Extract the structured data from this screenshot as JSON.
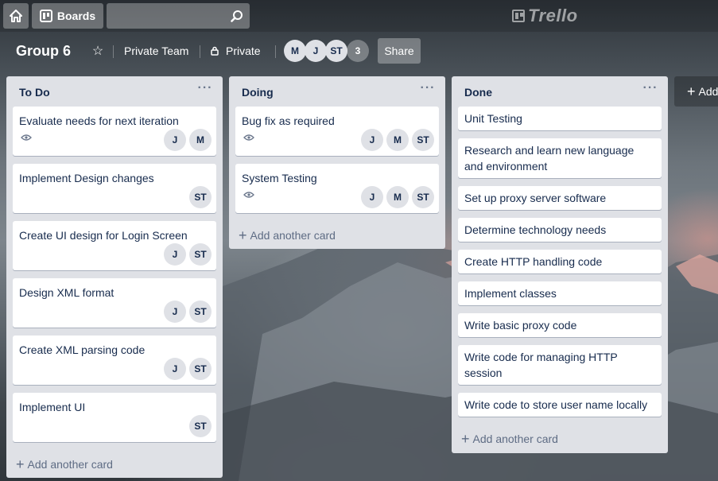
{
  "nav": {
    "home_icon": "home-icon",
    "boards_label": "Boards",
    "boards_icon": "boards-icon",
    "search_placeholder": "",
    "search_icon": "search-icon",
    "logo_text": "Trello"
  },
  "board": {
    "title": "Group 6",
    "star_icon": "star-icon",
    "team_label": "Private Team",
    "visibility_label": "Private",
    "visibility_icon": "lock-icon",
    "members": [
      "M",
      "J",
      "ST"
    ],
    "extra_members": "3",
    "share_label": "Share"
  },
  "lists": [
    {
      "title": "To Do",
      "cards": [
        {
          "title": "Evaluate needs for next iteration",
          "watch": true,
          "members": [
            "J",
            "M"
          ]
        },
        {
          "title": "Implement Design changes",
          "watch": false,
          "members": [
            "ST"
          ]
        },
        {
          "title": "Create UI design for Login Screen",
          "watch": false,
          "members": [
            "J",
            "ST"
          ]
        },
        {
          "title": "Design XML format",
          "watch": false,
          "members": [
            "J",
            "ST"
          ]
        },
        {
          "title": "Create XML parsing code",
          "watch": false,
          "members": [
            "J",
            "ST"
          ]
        },
        {
          "title": "Implement UI",
          "watch": false,
          "members": [
            "ST"
          ]
        }
      ],
      "add_label": "Add another card"
    },
    {
      "title": "Doing",
      "cards": [
        {
          "title": "Bug fix as required",
          "watch": true,
          "members": [
            "J",
            "M",
            "ST"
          ]
        },
        {
          "title": "System Testing",
          "watch": true,
          "members": [
            "J",
            "M",
            "ST"
          ]
        }
      ],
      "add_label": "Add another card"
    },
    {
      "title": "Done",
      "cards": [
        {
          "title": "Unit Testing"
        },
        {
          "title": "Research and learn new language and environment"
        },
        {
          "title": "Set up proxy server software"
        },
        {
          "title": "Determine technology needs"
        },
        {
          "title": "Create HTTP handling code"
        },
        {
          "title": "Implement classes"
        },
        {
          "title": "Write basic proxy code"
        },
        {
          "title": "Write code for managing HTTP session"
        },
        {
          "title": "Write code to store user name locally"
        }
      ],
      "add_label": "Add another card"
    }
  ],
  "add_list_label": "Add",
  "list_menu_icon": "more-icon",
  "watch_icon": "eye-icon",
  "plus_icon": "plus-icon"
}
